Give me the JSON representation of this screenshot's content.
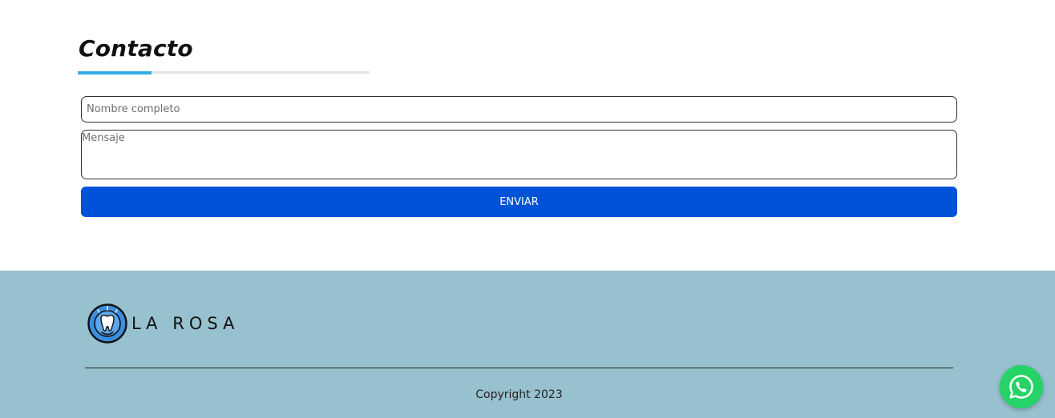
{
  "contact": {
    "title": "Contacto",
    "name_placeholder": "Nombre completo",
    "message_placeholder": "Mensaje",
    "send_label": "ENVIAR"
  },
  "footer": {
    "logo_text": "LA ROSA",
    "copyright": "Copyright 2023"
  },
  "icons": {
    "logo": "tooth-logo-icon",
    "whatsapp": "whatsapp-icon"
  },
  "colors": {
    "accent": "#2eaee8",
    "button": "#0052d9",
    "footer_bg": "#98c1cf",
    "whatsapp": "#25d366"
  }
}
